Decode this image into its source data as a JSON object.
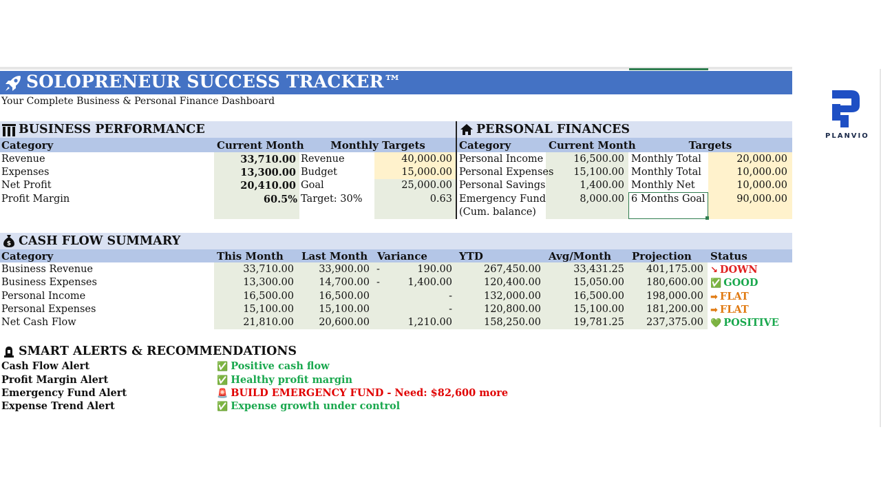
{
  "title": "SOLOPRENEUR SUCCESS TRACKER™",
  "subtitle": "Your Complete Business & Personal Finance Dashboard",
  "logo": {
    "name": "planvio-logo",
    "text": "PLANVIO",
    "color": "#1e4fc4"
  },
  "colors": {
    "title_bar": "#4472c4",
    "header_fill": "#b4c6e7",
    "section_fill": "#d9e1f2",
    "value_fill": "#e8ede0",
    "target_fill": "#fff2cc",
    "good": "#1aa84e",
    "bad": "#e00000",
    "flat": "#e07a12"
  },
  "business": {
    "title": "BUSINESS PERFORMANCE",
    "icon": "bar-chart-icon",
    "headers": {
      "category": "Category",
      "current": "Current Month",
      "targets": "Monthly Targets"
    },
    "rows": [
      {
        "category": "Revenue",
        "current": "33,710.00",
        "target_label": "Revenue",
        "target_value": "40,000.00"
      },
      {
        "category": "Expenses",
        "current": "13,300.00",
        "target_label": "Budget",
        "target_value": "15,000.00"
      },
      {
        "category": "Net Profit",
        "current": "20,410.00",
        "target_label": "Goal",
        "target_value": "25,000.00"
      },
      {
        "category": "Profit Margin",
        "current": "60.5%",
        "target_label": "Target: 30%",
        "target_value": "0.63"
      }
    ]
  },
  "personal": {
    "title": "PERSONAL FINANCES",
    "icon": "house-icon",
    "headers": {
      "category": "Category",
      "current": "Current Month",
      "targets": "Targets"
    },
    "rows": [
      {
        "category": "Personal Income",
        "current": "16,500.00",
        "target_label": "Monthly Total",
        "target_value": "20,000.00"
      },
      {
        "category": "Personal Expenses",
        "current": "15,100.00",
        "target_label": "Monthly Total",
        "target_value": "10,000.00"
      },
      {
        "category": "Personal Savings",
        "current": "1,400.00",
        "target_label": "Monthly Net",
        "target_value": "10,000.00"
      },
      {
        "category": "Emergency Fund",
        "category2": "(Cum. balance)",
        "current": "8,000.00",
        "target_label": "6 Months Goal",
        "target_value": "90,000.00"
      }
    ]
  },
  "cashflow": {
    "title": "CASH FLOW SUMMARY",
    "icon": "money-bag-icon",
    "headers": [
      "Category",
      "This Month",
      "Last Month",
      "Variance",
      "YTD",
      "Avg/Month",
      "Projection",
      "Status"
    ],
    "rows": [
      {
        "category": "Business Revenue",
        "this": "33,710.00",
        "last": "33,900.00",
        "var_sign": "-",
        "variance": "190.00",
        "ytd": "267,450.00",
        "avg": "33,431.25",
        "proj": "401,175.00",
        "status_icon": "↘",
        "status": "DOWN",
        "status_type": "down"
      },
      {
        "category": "Business Expenses",
        "this": "13,300.00",
        "last": "14,700.00",
        "var_sign": "-",
        "variance": "1,400.00",
        "ytd": "120,400.00",
        "avg": "15,050.00",
        "proj": "180,600.00",
        "status_icon": "✅",
        "status": "GOOD",
        "status_type": "good"
      },
      {
        "category": "Personal Income",
        "this": "16,500.00",
        "last": "16,500.00",
        "var_sign": "",
        "variance": "-",
        "ytd": "132,000.00",
        "avg": "16,500.00",
        "proj": "198,000.00",
        "status_icon": "➡",
        "status": "FLAT",
        "status_type": "flat"
      },
      {
        "category": "Personal Expenses",
        "this": "15,100.00",
        "last": "15,100.00",
        "var_sign": "",
        "variance": "-",
        "ytd": "120,800.00",
        "avg": "15,100.00",
        "proj": "181,200.00",
        "status_icon": "➡",
        "status": "FLAT",
        "status_type": "flat"
      },
      {
        "category": "Net Cash Flow",
        "this": "21,810.00",
        "last": "20,600.00",
        "var_sign": "",
        "variance": "1,210.00",
        "ytd": "158,250.00",
        "avg": "19,781.25",
        "proj": "237,375.00",
        "status_icon": "💚",
        "status": "POSITIVE",
        "status_type": "pos"
      }
    ]
  },
  "alerts": {
    "title": "SMART ALERTS & RECOMMENDATIONS",
    "icon": "siren-icon",
    "rows": [
      {
        "label": "Cash Flow Alert",
        "icon": "✅",
        "message": "Positive cash flow",
        "type": "good"
      },
      {
        "label": "Profit Margin Alert",
        "icon": "✅",
        "message": "Healthy profit margin",
        "type": "good"
      },
      {
        "label": "Emergency Fund Alert",
        "icon": "🚨",
        "message": "BUILD EMERGENCY FUND - Need: $82,600 more",
        "type": "bad"
      },
      {
        "label": "Expense Trend Alert",
        "icon": "✅",
        "message": "Expense growth under control",
        "type": "good"
      }
    ]
  }
}
